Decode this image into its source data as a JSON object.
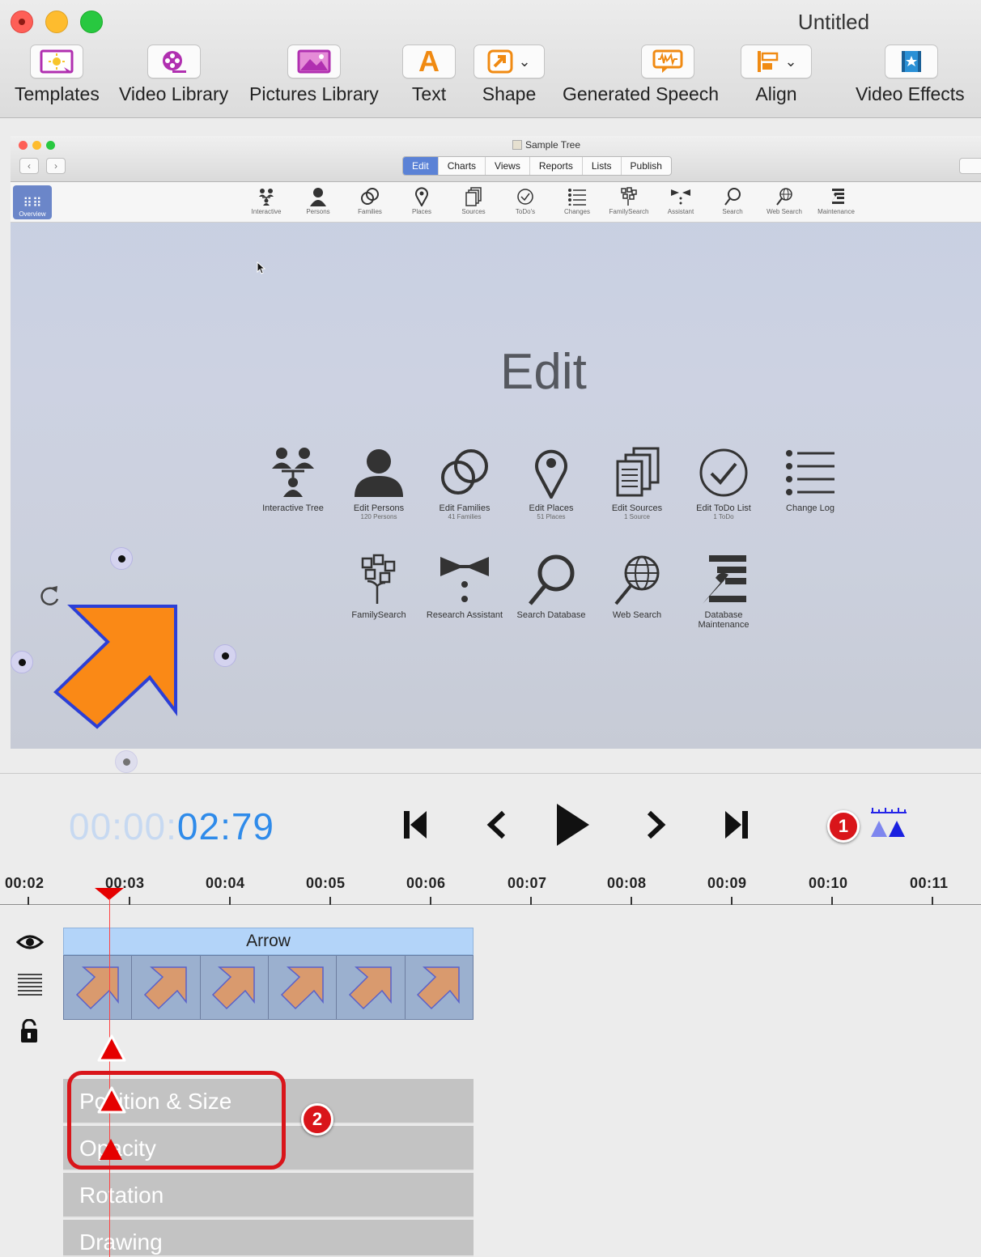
{
  "window": {
    "title": "Untitled"
  },
  "toolbar": {
    "templates": "Templates",
    "video_library": "Video Library",
    "pictures_library": "Pictures Library",
    "text": "Text",
    "shape": "Shape",
    "generated_speech": "Generated Speech",
    "align": "Align",
    "video_effects": "Video Effects"
  },
  "canvas": {
    "app_title": "Sample Tree",
    "tabs": [
      "Edit",
      "Charts",
      "Views",
      "Reports",
      "Lists",
      "Publish"
    ],
    "overview_label": "Overview",
    "toolbar_items": [
      "Interactive",
      "Persons",
      "Families",
      "Places",
      "Sources",
      "ToDo's",
      "Changes",
      "FamilySearch",
      "Assistant",
      "Search",
      "Web Search",
      "Maintenance"
    ],
    "heading": "Edit",
    "row1": [
      {
        "label": "Interactive Tree",
        "sub": ""
      },
      {
        "label": "Edit Persons",
        "sub": "120 Persons"
      },
      {
        "label": "Edit Families",
        "sub": "41 Families"
      },
      {
        "label": "Edit Places",
        "sub": "51 Places"
      },
      {
        "label": "Edit Sources",
        "sub": "1 Source"
      },
      {
        "label": "Edit ToDo List",
        "sub": "1 ToDo"
      },
      {
        "label": "Change Log",
        "sub": ""
      }
    ],
    "row2": [
      {
        "label": "FamilySearch"
      },
      {
        "label": "Research Assistant"
      },
      {
        "label": "Search Database"
      },
      {
        "label": "Web Search"
      },
      {
        "label": "Database",
        "label2": "Maintenance"
      }
    ],
    "arrow_color": "#fa8916",
    "arrow_stroke": "#2c3fd6"
  },
  "timeline": {
    "timecode_dim": "00:00:",
    "timecode_bright": "02:79",
    "ruler": [
      "00:02",
      "00:03",
      "00:04",
      "00:05",
      "00:06",
      "00:07",
      "00:08",
      "00:09",
      "00:10",
      "00:11"
    ],
    "clip_name": "Arrow",
    "properties": [
      "Position & Size",
      "Opacity",
      "Rotation",
      "Drawing"
    ],
    "callouts": [
      "1",
      "2"
    ],
    "accent": "#2f8bea",
    "playhead_color": "#e50000"
  }
}
